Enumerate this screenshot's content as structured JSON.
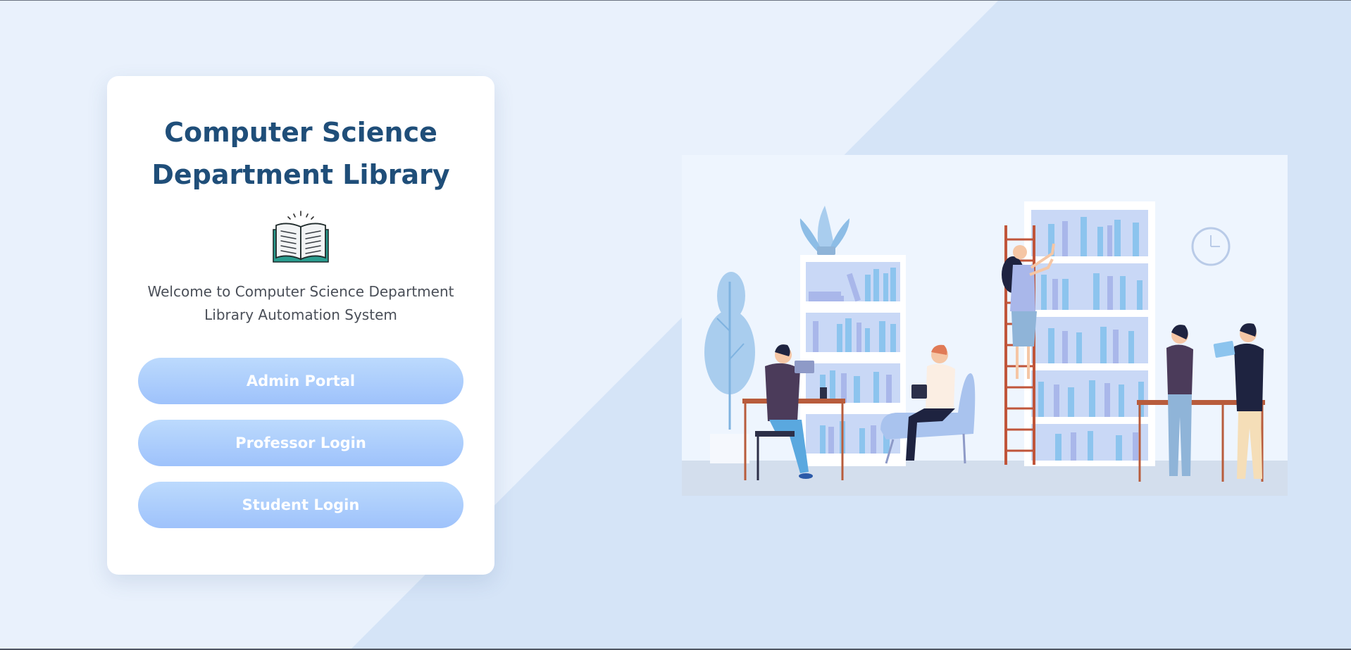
{
  "card": {
    "title_line1": "Computer Science",
    "title_line2": "Department Library",
    "book_icon": "open-book-icon",
    "welcome_line1": "Welcome to Computer Science Department",
    "welcome_line2": "Library Automation System"
  },
  "buttons": {
    "admin_label": "Admin Portal",
    "professor_label": "Professor Login",
    "student_label": "Student Login"
  },
  "illustration": {
    "scene": "library-reading-room-illustration"
  },
  "colors": {
    "page_background": "#e9f1fc",
    "diagonal_band": "#d5e4f7",
    "title": "#1f4e79",
    "button_top": "#bcdafd",
    "button_bottom": "#9ec2fb",
    "button_text": "#ffffff"
  }
}
